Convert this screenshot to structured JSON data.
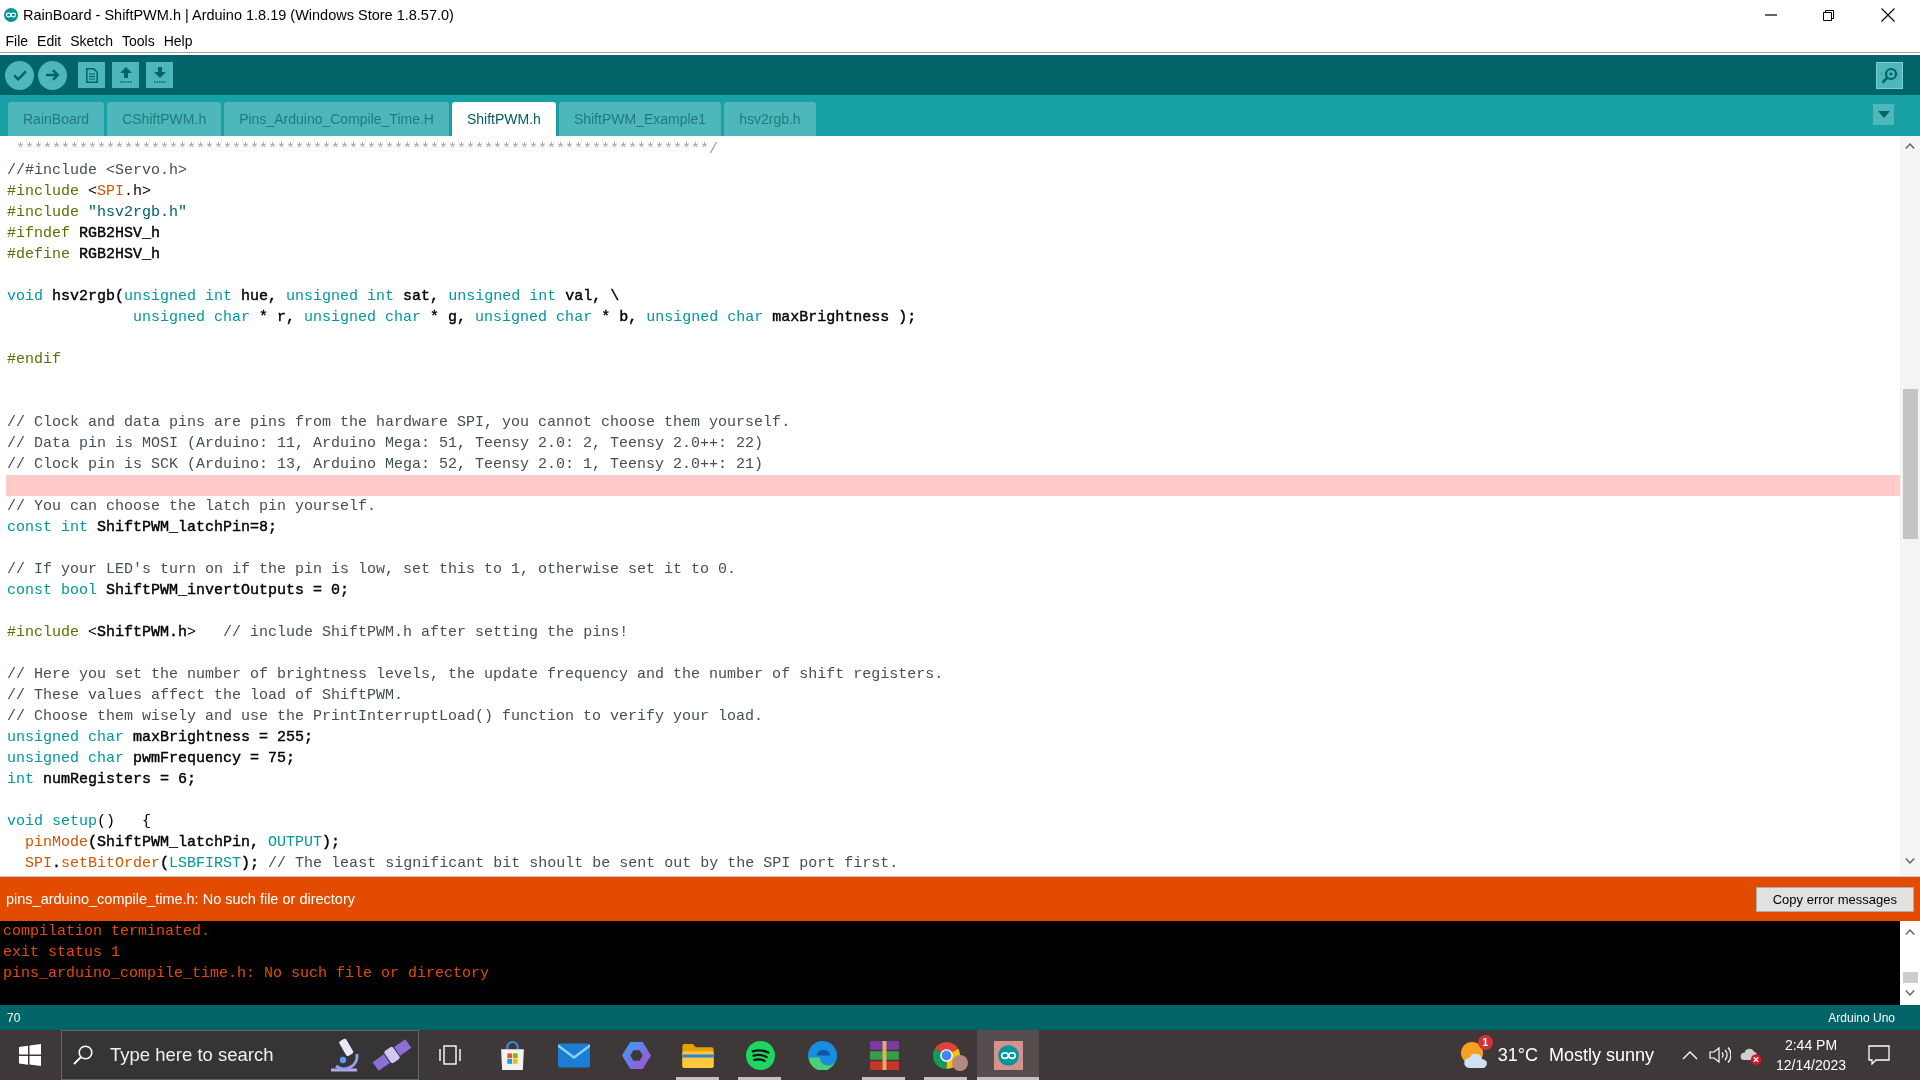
{
  "window": {
    "title": "RainBoard - ShiftPWM.h | Arduino 1.8.19 (Windows Store 1.8.57.0)"
  },
  "menu": [
    "File",
    "Edit",
    "Sketch",
    "Tools",
    "Help"
  ],
  "tabs": [
    {
      "label": "RainBoard",
      "selected": false
    },
    {
      "label": "CShiftPWM.h",
      "selected": false
    },
    {
      "label": "Pins_Arduino_Compile_Time.H",
      "selected": false
    },
    {
      "label": "ShiftPWM.h",
      "selected": true
    },
    {
      "label": "ShiftPWM_Example1",
      "selected": false
    },
    {
      "label": "hsv2rgb.h",
      "selected": false
    }
  ],
  "editor": {
    "lines": [
      {
        "highlighted": false,
        "tokens": [
          {
            "kind": "block_comment",
            "text": " *****************************************************************************/"
          }
        ]
      },
      {
        "highlighted": false,
        "tokens": [
          {
            "kind": "comment",
            "text": "//#include <Servo.h>"
          }
        ]
      },
      {
        "highlighted": false,
        "tokens": [
          {
            "kind": "preprocessor",
            "text": "#include"
          },
          {
            "kind": "punct",
            "text": " <"
          },
          {
            "kind": "function",
            "text": "SPI"
          },
          {
            "kind": "punct",
            "text": ".h>"
          }
        ]
      },
      {
        "highlighted": false,
        "tokens": [
          {
            "kind": "preprocessor",
            "text": "#include "
          },
          {
            "kind": "string",
            "text": "\"hsv2rgb.h\""
          }
        ]
      },
      {
        "highlighted": false,
        "tokens": [
          {
            "kind": "preprocessor",
            "text": "#ifndef"
          },
          {
            "kind": "plain",
            "text": " RGB2HSV_h"
          }
        ]
      },
      {
        "highlighted": false,
        "tokens": [
          {
            "kind": "preprocessor",
            "text": "#define"
          },
          {
            "kind": "plain",
            "text": " RGB2HSV_h"
          }
        ]
      },
      {
        "highlighted": false
      },
      {
        "highlighted": false,
        "tokens": [
          {
            "kind": "type",
            "text": "void"
          },
          {
            "kind": "plain",
            "text": " hsv2rgb("
          },
          {
            "kind": "type",
            "text": "unsigned int"
          },
          {
            "kind": "plain",
            "text": " hue, "
          },
          {
            "kind": "type",
            "text": "unsigned int"
          },
          {
            "kind": "plain",
            "text": " sat, "
          },
          {
            "kind": "type",
            "text": "unsigned int"
          },
          {
            "kind": "plain",
            "text": " val, \\"
          }
        ]
      },
      {
        "highlighted": false,
        "tokens": [
          {
            "kind": "type",
            "text": "              unsigned char"
          },
          {
            "kind": "plain",
            "text": " * r, "
          },
          {
            "kind": "type",
            "text": "unsigned char"
          },
          {
            "kind": "plain",
            "text": " * g, "
          },
          {
            "kind": "type",
            "text": "unsigned char"
          },
          {
            "kind": "plain",
            "text": " * b, "
          },
          {
            "kind": "type",
            "text": "unsigned char"
          },
          {
            "kind": "plain",
            "text": " maxBrightness );"
          }
        ]
      },
      {
        "highlighted": false
      },
      {
        "highlighted": false,
        "tokens": [
          {
            "kind": "preprocessor",
            "text": "#endif"
          }
        ]
      },
      {
        "highlighted": false
      },
      {
        "highlighted": false
      },
      {
        "highlighted": false,
        "tokens": [
          {
            "kind": "comment",
            "text": "// Clock and data pins are pins from the hardware SPI, you cannot choose them yourself."
          }
        ]
      },
      {
        "highlighted": false,
        "tokens": [
          {
            "kind": "comment",
            "text": "// Data pin is MOSI (Arduino: 11, Arduino Mega: 51, Teensy 2.0: 2, Teensy 2.0++: 22)"
          }
        ]
      },
      {
        "highlighted": false,
        "tokens": [
          {
            "kind": "comment",
            "text": "// Clock pin is SCK (Arduino: 13, Arduino Mega: 52, Teensy 2.0: 1, Teensy 2.0++: 21)"
          }
        ]
      },
      {
        "highlighted": true
      },
      {
        "highlighted": false,
        "tokens": [
          {
            "kind": "comment",
            "text": "// You can choose the latch pin yourself."
          }
        ]
      },
      {
        "highlighted": false,
        "tokens": [
          {
            "kind": "type",
            "text": "const int"
          },
          {
            "kind": "plain",
            "text": " ShiftPWM_latchPin=8;"
          }
        ]
      },
      {
        "highlighted": false
      },
      {
        "highlighted": false,
        "tokens": [
          {
            "kind": "comment",
            "text": "// If your LED's turn on if the pin is low, set this to 1, otherwise set it to 0."
          }
        ]
      },
      {
        "highlighted": false,
        "tokens": [
          {
            "kind": "type",
            "text": "const bool"
          },
          {
            "kind": "plain",
            "text": " ShiftPWM_invertOutputs = 0;"
          }
        ]
      },
      {
        "highlighted": false
      },
      {
        "highlighted": false,
        "tokens": [
          {
            "kind": "preprocessor",
            "text": "#include"
          },
          {
            "kind": "punct",
            "text": " <"
          },
          {
            "kind": "plain",
            "text": "ShiftPWM.h"
          },
          {
            "kind": "punct",
            "text": ">"
          },
          {
            "kind": "comment",
            "text": "   // include ShiftPWM.h after setting the pins!"
          }
        ]
      },
      {
        "highlighted": false
      },
      {
        "highlighted": false,
        "tokens": [
          {
            "kind": "comment",
            "text": "// Here you set the number of brightness levels, the update frequency and the number of shift registers."
          }
        ]
      },
      {
        "highlighted": false,
        "tokens": [
          {
            "kind": "comment",
            "text": "// These values affect the load of ShiftPWM."
          }
        ]
      },
      {
        "highlighted": false,
        "tokens": [
          {
            "kind": "comment",
            "text": "// Choose them wisely and use the PrintInterruptLoad() function to verify your load."
          }
        ]
      },
      {
        "highlighted": false,
        "tokens": [
          {
            "kind": "type",
            "text": "unsigned char"
          },
          {
            "kind": "plain",
            "text": " maxBrightness = 255;"
          }
        ]
      },
      {
        "highlighted": false,
        "tokens": [
          {
            "kind": "type",
            "text": "unsigned char"
          },
          {
            "kind": "plain",
            "text": " pwmFrequency = 75;"
          }
        ]
      },
      {
        "highlighted": false,
        "tokens": [
          {
            "kind": "type",
            "text": "int"
          },
          {
            "kind": "plain",
            "text": " numRegisters = 6;"
          }
        ]
      },
      {
        "highlighted": false
      },
      {
        "highlighted": false,
        "tokens": [
          {
            "kind": "type",
            "text": "void setup"
          },
          {
            "kind": "punct",
            "text": "()   {"
          }
        ]
      },
      {
        "highlighted": false,
        "tokens": [
          {
            "kind": "function",
            "text": "  pinMode"
          },
          {
            "kind": "plain",
            "text": "(ShiftPWM_latchPin, "
          },
          {
            "kind": "constant",
            "text": "OUTPUT"
          },
          {
            "kind": "plain",
            "text": ");"
          }
        ]
      },
      {
        "highlighted": false,
        "tokens": [
          {
            "kind": "function",
            "text": "  SPI"
          },
          {
            "kind": "plain",
            "text": "."
          },
          {
            "kind": "function",
            "text": "setBitOrder"
          },
          {
            "kind": "plain",
            "text": "("
          },
          {
            "kind": "constant",
            "text": "LSBFIRST"
          },
          {
            "kind": "plain",
            "text": ");"
          },
          {
            "kind": "comment",
            "text": " // The least significant bit shoult be sent out by the SPI port first."
          }
        ]
      }
    ]
  },
  "error_bar": {
    "message": "pins_arduino_compile_time.h: No such file or directory",
    "button": "Copy error messages"
  },
  "console": {
    "lines": [
      "compilation terminated.",
      "exit status 1",
      "pins_arduino_compile_time.h: No such file or directory"
    ]
  },
  "status_bar": {
    "line": "70",
    "board": "Arduino Uno"
  },
  "taskbar": {
    "search": {
      "placeholder": "Type here to search"
    },
    "apps": [
      {
        "kind": "bag",
        "running": false,
        "selected": false
      },
      {
        "kind": "envelope",
        "running": false,
        "selected": false
      },
      {
        "kind": "loop",
        "running": false,
        "selected": false
      },
      {
        "kind": "folder",
        "running": true,
        "selected": false
      },
      {
        "kind": "waves",
        "running": true,
        "selected": false
      },
      {
        "kind": "swirl",
        "running": false,
        "selected": false
      },
      {
        "kind": "books",
        "running": true,
        "selected": false
      },
      {
        "kind": "ring",
        "running": true,
        "selected": false
      },
      {
        "kind": "infinity",
        "running": true,
        "selected": true
      }
    ],
    "weather": {
      "badge": "1",
      "temperature": "31°C",
      "condition": "Mostly sunny"
    },
    "clock": {
      "time": "2:44 PM",
      "date": "12/14/2023"
    }
  }
}
